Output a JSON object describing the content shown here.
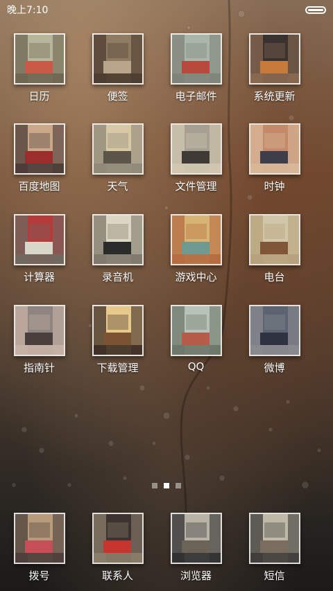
{
  "status": {
    "time": "晚上7:10"
  },
  "apps": [
    {
      "label": "日历",
      "icon": "calendar-icon",
      "colors": [
        "#b7b59a",
        "#c95a48",
        "#6e6550"
      ]
    },
    {
      "label": "便签",
      "icon": "notes-icon",
      "colors": [
        "#8f7b62",
        "#b8a58a",
        "#4d3d31"
      ]
    },
    {
      "label": "电子邮件",
      "icon": "email-icon",
      "colors": [
        "#aab6a8",
        "#b74a3c",
        "#7f8478"
      ]
    },
    {
      "label": "系统更新",
      "icon": "update-icon",
      "colors": [
        "#3a3230",
        "#c77b3a",
        "#8b6a50"
      ]
    },
    {
      "label": "百度地图",
      "icon": "map-icon",
      "colors": [
        "#caa98a",
        "#9c2d2d",
        "#4a3b36"
      ]
    },
    {
      "label": "天气",
      "icon": "weather-icon",
      "colors": [
        "#d7c9a5",
        "#5d544a",
        "#8f8778"
      ]
    },
    {
      "label": "文件管理",
      "icon": "files-icon",
      "colors": [
        "#a7a092",
        "#3f3a36",
        "#d2c8b0"
      ]
    },
    {
      "label": "时钟",
      "icon": "clock-icon",
      "colors": [
        "#c38b6a",
        "#3f3e4b",
        "#d8b89a"
      ]
    },
    {
      "label": "计算器",
      "icon": "calculator-icon",
      "colors": [
        "#b53a3a",
        "#d9d6ca",
        "#6e6a62"
      ]
    },
    {
      "label": "录音机",
      "icon": "recorder-icon",
      "colors": [
        "#dcd7c4",
        "#2b2b2b",
        "#7d776a"
      ]
    },
    {
      "label": "游戏中心",
      "icon": "game-icon",
      "colors": [
        "#d6b473",
        "#6f9a91",
        "#b56b3f"
      ]
    },
    {
      "label": "电台",
      "icon": "radio-icon",
      "colors": [
        "#cfc7a8",
        "#7f5638",
        "#b7a17b"
      ]
    },
    {
      "label": "指南针",
      "icon": "compass-icon",
      "colors": [
        "#8e8480",
        "#4a3f3c",
        "#c7b3a6"
      ]
    },
    {
      "label": "下载管理",
      "icon": "download-icon",
      "colors": [
        "#e8c98c",
        "#7a5432",
        "#3c2d25"
      ]
    },
    {
      "label": "QQ",
      "icon": "qq-icon",
      "colors": [
        "#b8c2b9",
        "#b65a4a",
        "#6c7668"
      ]
    },
    {
      "label": "微博",
      "icon": "weibo-icon",
      "colors": [
        "#5c6472",
        "#2f3240",
        "#8a8b8f"
      ]
    }
  ],
  "dock": [
    {
      "label": "拨号",
      "icon": "phone-icon",
      "colors": [
        "#b79b7a",
        "#c64e57",
        "#4b3d3a"
      ]
    },
    {
      "label": "联系人",
      "icon": "contacts-icon",
      "colors": [
        "#3d3431",
        "#c7352f",
        "#8c7f6c"
      ]
    },
    {
      "label": "浏览器",
      "icon": "browser-icon",
      "colors": [
        "#b9b3a5",
        "#6b6358",
        "#2f2f31"
      ]
    },
    {
      "label": "短信",
      "icon": "messages-icon",
      "colors": [
        "#bfb9a8",
        "#7a6c5e",
        "#3e3c38"
      ]
    }
  ],
  "pager": {
    "count": 3,
    "active": 1
  }
}
